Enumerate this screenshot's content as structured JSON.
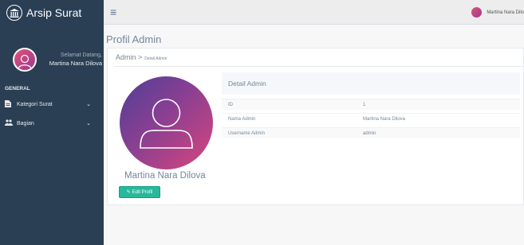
{
  "sidebar": {
    "brand_title": "Arsip Surat",
    "welcome": "Selamat Datang,",
    "user_name": "Martina Nara Dilova",
    "section_label": "GENERAL",
    "items": [
      {
        "label": "Kategori Surat",
        "icon": "file-icon"
      },
      {
        "label": "Bagian",
        "icon": "users-icon"
      }
    ]
  },
  "topnav": {
    "user_name": "Martina Nara Dilo"
  },
  "page": {
    "title": "Profil Admin",
    "breadcrumb_main": "Admin >",
    "breadcrumb_sub": "Detail Admin"
  },
  "profile": {
    "name": "Martina Nara Dilova",
    "edit_label": "Edit Profil"
  },
  "detail": {
    "header": "Detail Admin",
    "rows": [
      {
        "key": "ID",
        "value": "1"
      },
      {
        "key": "Nama Admin",
        "value": "Martina Nara Dilova"
      },
      {
        "key": "Username Admin",
        "value": "admin"
      }
    ]
  },
  "colors": {
    "sidebar_bg": "#2a3f54",
    "button_green": "#26b99a"
  }
}
